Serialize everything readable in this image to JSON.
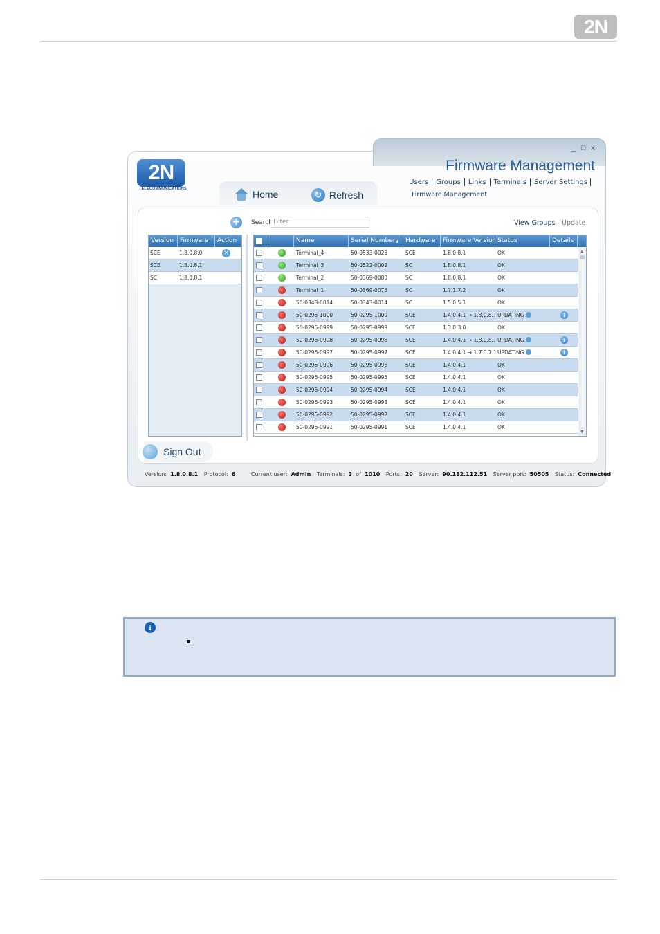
{
  "document": {
    "brand_logo": "2N"
  },
  "window": {
    "controls": [
      "_",
      "□",
      "x"
    ],
    "logo_text": "2N",
    "logo_subtext": "TELECOMMUNICATIONS",
    "title": "Firmware Management",
    "nav": [
      "Users",
      "Groups",
      "Links",
      "Terminals",
      "Server Settings"
    ],
    "sub_nav": "Firmware Management",
    "home_label": "Home",
    "refresh_label": "Refresh",
    "sign_out_label": "Sign Out"
  },
  "left_table": {
    "columns": [
      "Version",
      "Firmware",
      "Action"
    ],
    "rows": [
      {
        "version": "SCE",
        "firmware": "1.8.0.8.0",
        "action": true
      },
      {
        "version": "SCE",
        "firmware": "1.8.0.8.1",
        "action": false
      },
      {
        "version": "SC",
        "firmware": "1.8.0.8.1",
        "action": false
      }
    ]
  },
  "search": {
    "label": "Search",
    "placeholder": "Filter"
  },
  "toolbar": {
    "view_groups": "View Groups",
    "update": "Update"
  },
  "grid": {
    "columns": [
      "",
      "",
      "Name",
      "Serial Number",
      "Hardware",
      "Firmware Version",
      "Status",
      "Details"
    ],
    "sort_indicator": "▲",
    "rows": [
      {
        "led": "green",
        "name": "Terminal_4",
        "serial": "50-0533-0025",
        "hw": "SCE",
        "fw": "1.8.0.8.1",
        "status": "OK",
        "details": false
      },
      {
        "led": "green",
        "name": "Terminal_3",
        "serial": "50-0522-0002",
        "hw": "SC",
        "fw": "1.8.0.8.1",
        "status": "OK",
        "details": false
      },
      {
        "led": "green",
        "name": "Terminal_2",
        "serial": "50-0369-0080",
        "hw": "SC",
        "fw": "1.8.0.8.1",
        "status": "OK",
        "details": false
      },
      {
        "led": "red",
        "name": "Terminal_1",
        "serial": "50-0369-0075",
        "hw": "SC",
        "fw": "1.7.1.7.2",
        "status": "OK",
        "details": false
      },
      {
        "led": "red",
        "name": "50-0343-0014",
        "serial": "50-0343-0014",
        "hw": "SC",
        "fw": "1.5.0.5.1",
        "status": "OK",
        "details": false
      },
      {
        "led": "red",
        "name": "50-0295-1000",
        "serial": "50-0295-1000",
        "hw": "SCE",
        "fw": "1.4.0.4.1 → 1.8.0.8.1",
        "status": "UPDATING",
        "details": true
      },
      {
        "led": "red",
        "name": "50-0295-0999",
        "serial": "50-0295-0999",
        "hw": "SCE",
        "fw": "1.3.0.3.0",
        "status": "OK",
        "details": false
      },
      {
        "led": "red",
        "name": "50-0295-0998",
        "serial": "50-0295-0998",
        "hw": "SCE",
        "fw": "1.4.0.4.1 → 1.8.0.8.1",
        "status": "UPDATING",
        "details": true
      },
      {
        "led": "red",
        "name": "50-0295-0997",
        "serial": "50-0295-0997",
        "hw": "SCE",
        "fw": "1.4.0.4.1 → 1.7.0.7.1",
        "status": "UPDATING",
        "details": true
      },
      {
        "led": "red",
        "name": "50-0295-0996",
        "serial": "50-0295-0996",
        "hw": "SCE",
        "fw": "1.4.0.4.1",
        "status": "OK",
        "details": false
      },
      {
        "led": "red",
        "name": "50-0295-0995",
        "serial": "50-0295-0995",
        "hw": "SCE",
        "fw": "1.4.0.4.1",
        "status": "OK",
        "details": false
      },
      {
        "led": "red",
        "name": "50-0295-0994",
        "serial": "50-0295-0994",
        "hw": "SCE",
        "fw": "1.4.0.4.1",
        "status": "OK",
        "details": false
      },
      {
        "led": "red",
        "name": "50-0295-0993",
        "serial": "50-0295-0993",
        "hw": "SCE",
        "fw": "1.4.0.4.1",
        "status": "OK",
        "details": false
      },
      {
        "led": "red",
        "name": "50-0295-0992",
        "serial": "50-0295-0992",
        "hw": "SCE",
        "fw": "1.4.0.4.1",
        "status": "OK",
        "details": false
      },
      {
        "led": "red",
        "name": "50-0295-0991",
        "serial": "50-0295-0991",
        "hw": "SCE",
        "fw": "1.4.0.4.1",
        "status": "OK",
        "details": false
      }
    ]
  },
  "status_bar": {
    "version_label": "Version:",
    "version": "1.8.0.8.1",
    "protocol_label": "Protocol:",
    "protocol": "6",
    "user_label": "Current user:",
    "user": "Admin",
    "terminals_label": "Terminals:",
    "terminals_count": "3",
    "of_label": "of",
    "terminals_total": "1010",
    "ports_label": "Ports:",
    "ports": "20",
    "server_label": "Server:",
    "server": "90.182.112.51",
    "server_port_label": "Server port:",
    "server_port": "50505",
    "status_label": "Status:",
    "status": "Connected"
  },
  "colors": {
    "header_blue": "#2f6fb0",
    "row_alt": "#c9dbee",
    "led_green": "#2f9a1c",
    "led_red": "#b51d17",
    "title_blue": "#2c5f93",
    "info_box_bg": "#dce5f2"
  },
  "icons": {
    "info_box": "info-icon",
    "bullet": "square-bullet"
  }
}
